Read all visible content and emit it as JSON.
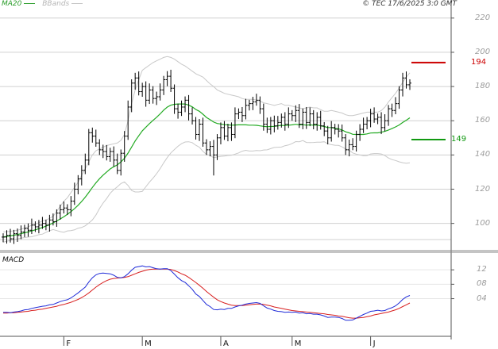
{
  "header": {
    "ma_label": "MA20",
    "bb_label": "BBands",
    "copyright": "© TEC 17/6/2025 3:0 GMT"
  },
  "panels": {
    "macd_title": "MACD"
  },
  "targets": {
    "upper": {
      "value": 194,
      "label": "194",
      "color": "#cc0000"
    },
    "lower": {
      "value": 149,
      "label": "149",
      "color": "#119911"
    }
  },
  "colors": {
    "bars": "#000000",
    "ma": "#22aa22",
    "bb": "#c8c8c8",
    "grid": "#d0d0d0",
    "macd": "#1f2bd8",
    "signal": "#d81f1f",
    "axis": "#555555"
  },
  "chart_data": [
    {
      "type": "ohlc",
      "title": "",
      "y_ticks": [
        "220",
        "200",
        "180",
        "160",
        "140",
        "120",
        "100"
      ],
      "y_tick_values": [
        220,
        200,
        180,
        160,
        140,
        120,
        100
      ],
      "ylim": [
        85,
        225
      ],
      "x_ticks": [
        "F",
        "M",
        "A",
        "M",
        "J"
      ],
      "x_tick_index": [
        17,
        39,
        61,
        81,
        103
      ],
      "grid": true,
      "series": [
        {
          "name": "Price",
          "close": [
            92,
            93,
            91,
            94,
            93,
            95,
            97,
            96,
            99,
            98,
            99,
            100,
            99,
            102,
            101,
            106,
            108,
            109,
            108,
            113,
            120,
            126,
            131,
            137,
            153,
            151,
            147,
            143,
            142,
            139,
            142,
            137,
            131,
            141,
            151,
            168,
            182,
            185,
            177,
            180,
            172,
            178,
            173,
            174,
            178,
            184,
            186,
            179,
            167,
            165,
            168,
            172,
            164,
            160,
            152,
            158,
            147,
            143,
            145,
            140,
            150,
            156,
            151,
            156,
            152,
            164,
            165,
            163,
            169,
            170,
            171,
            172,
            167,
            158,
            155,
            160,
            157,
            159,
            162,
            158,
            164,
            163,
            166,
            158,
            165,
            159,
            164,
            158,
            162,
            157,
            154,
            150,
            156,
            155,
            154,
            150,
            143,
            146,
            145,
            152,
            155,
            158,
            160,
            164,
            161,
            162,
            156,
            160,
            167,
            166,
            170,
            178,
            185,
            181,
            182
          ]
        },
        {
          "name": "MA20",
          "values": [
            92,
            92.4,
            92.7,
            93.1,
            93.5,
            94.0,
            94.5,
            95.0,
            95.6,
            96.2,
            96.9,
            97.6,
            98.4,
            99.3,
            100.3,
            101.4,
            102.6,
            103.9,
            105.3,
            106.9,
            108.6,
            110.6,
            112.8,
            115.3,
            118.1,
            121.0,
            123.7,
            126.1,
            128.2,
            130.0,
            131.8,
            133.1,
            134.2,
            135.9,
            138.1,
            141.1,
            144.6,
            148.2,
            151.2,
            154.1,
            156.2,
            158.3,
            160.2,
            162.0,
            164.0,
            166.2,
            168.0,
            169.1,
            169.6,
            169.8,
            169.8,
            169.8,
            169.1,
            168.1,
            166.6,
            165.5,
            163.8,
            161.9,
            160.6,
            159.2,
            158.4,
            158.1,
            157.7,
            157.6,
            157.4,
            157.5,
            157.6,
            157.6,
            157.6,
            157.4,
            157.4,
            157.3,
            157.0,
            156.7,
            156.5,
            156.6,
            156.7,
            157.0,
            157.3,
            157.2,
            157.4,
            157.6,
            157.9,
            157.6,
            157.7,
            157.4,
            157.6,
            157.4,
            157.5,
            157.0,
            156.6,
            156.0,
            156.0,
            155.6,
            155.3,
            154.6,
            153.5,
            152.9,
            152.1,
            152.0,
            152.0,
            152.0,
            152.3,
            152.8,
            152.9,
            152.9,
            153.3,
            153.8,
            154.6,
            155.4,
            156.4,
            157.5,
            159.0,
            160.3,
            161.7
          ]
        },
        {
          "name": "BBands",
          "upper": [
            95,
            95.2,
            95.4,
            95.7,
            96.0,
            96.6,
            97.3,
            98.0,
            99.0,
            99.6,
            100.4,
            101.5,
            102.0,
            102.9,
            104.2,
            107.0,
            110.0,
            113.0,
            115.0,
            118.0,
            121.0,
            124.0,
            128.0,
            132.0,
            136.0,
            140.0,
            142.5,
            143.5,
            144.5,
            145.5,
            146.0,
            146.5,
            147.0,
            148.5,
            152.0,
            160.0,
            170.0,
            178.0,
            184.0,
            189.5,
            191.0,
            192.5,
            194.0,
            195.0,
            196.0,
            197.0,
            197.5,
            197.0,
            196.0,
            194.5,
            193.0,
            192.0,
            190.5,
            189.0,
            187.5,
            186.5,
            185.5,
            183.5,
            181.5,
            180.0,
            178.0,
            177.0,
            176.0,
            175.5,
            175.0,
            174.5,
            174.0,
            173.0,
            172.5,
            172.5,
            172.5,
            172.0,
            171.5,
            170.5,
            170.0,
            169.5,
            169.0,
            169.5,
            170.0,
            169.0,
            169.0,
            168.5,
            168.0,
            167.5,
            167.0,
            167.5,
            168.0,
            167.5,
            167.5,
            166.5,
            165.5,
            165.5,
            166.0,
            165.5,
            165.0,
            164.5,
            163.5,
            163.0,
            163.0,
            163.5,
            164.0,
            164.5,
            165.0,
            165.0,
            165.0,
            165.0,
            166.0,
            168.0,
            171.0,
            173.5,
            176.0,
            179.0,
            182.5,
            185.5,
            188.0
          ],
          "lower": [
            89,
            89.6,
            90.0,
            90.5,
            91.0,
            91.4,
            91.7,
            92.0,
            92.2,
            92.8,
            93.4,
            93.7,
            94.8,
            95.7,
            96.4,
            95.8,
            95.2,
            94.8,
            95.6,
            95.8,
            96.2,
            97.2,
            97.6,
            98.6,
            100.2,
            102.0,
            104.9,
            108.7,
            111.9,
            114.5,
            117.6,
            119.7,
            121.4,
            123.3,
            124.2,
            122.2,
            119.2,
            118.4,
            118.4,
            118.7,
            121.4,
            124.1,
            126.4,
            129.0,
            132.0,
            135.4,
            138.5,
            141.2,
            143.2,
            145.1,
            146.6,
            147.6,
            147.7,
            147.2,
            145.7,
            144.5,
            142.1,
            140.3,
            139.7,
            138.4,
            138.8,
            139.2,
            139.4,
            139.7,
            139.8,
            140.5,
            141.2,
            142.2,
            142.7,
            142.3,
            142.3,
            142.6,
            142.5,
            142.9,
            143.0,
            143.7,
            144.4,
            144.5,
            144.6,
            145.4,
            145.8,
            146.7,
            147.8,
            147.7,
            148.4,
            147.3,
            147.2,
            147.3,
            147.5,
            147.5,
            147.7,
            146.5,
            146.0,
            145.7,
            145.6,
            144.7,
            143.5,
            142.8,
            141.2,
            140.5,
            140.0,
            139.5,
            139.6,
            140.6,
            140.8,
            140.8,
            140.6,
            139.6,
            138.2,
            137.3,
            136.8,
            136.0,
            135.5,
            135.1,
            135.4
          ]
        }
      ]
    },
    {
      "type": "line",
      "title": "MACD",
      "y_ticks": [
        "12",
        "08",
        "04"
      ],
      "y_tick_values": [
        12,
        8,
        4
      ],
      "ylim": [
        -6,
        16
      ],
      "series": [
        {
          "name": "MACD",
          "values": [
            0.2,
            0.2,
            0.1,
            0.3,
            0.4,
            0.6,
            0.9,
            1.0,
            1.3,
            1.5,
            1.7,
            1.9,
            2.0,
            2.3,
            2.4,
            2.8,
            3.2,
            3.5,
            3.7,
            4.2,
            4.9,
            5.6,
            6.4,
            7.2,
            8.6,
            9.8,
            10.6,
            11.0,
            11.1,
            11.0,
            10.9,
            10.5,
            9.9,
            9.8,
            10.1,
            10.9,
            11.9,
            12.7,
            12.9,
            13.1,
            12.8,
            12.9,
            12.6,
            12.3,
            12.2,
            12.3,
            12.3,
            11.8,
            10.8,
            9.8,
            9.0,
            8.5,
            7.6,
            6.6,
            5.3,
            4.6,
            3.5,
            2.4,
            1.8,
            1.0,
            0.9,
            1.1,
            1.0,
            1.3,
            1.3,
            1.7,
            2.0,
            2.2,
            2.5,
            2.7,
            2.8,
            2.9,
            2.7,
            2.0,
            1.4,
            1.1,
            0.7,
            0.5,
            0.4,
            0.2,
            0.3,
            0.2,
            0.3,
            0.0,
            0.1,
            -0.2,
            -0.1,
            -0.3,
            -0.3,
            -0.5,
            -0.8,
            -1.2,
            -1.1,
            -1.1,
            -1.2,
            -1.5,
            -2.0,
            -2.0,
            -1.9,
            -1.4,
            -0.9,
            -0.4,
            0.0,
            0.5,
            0.6,
            0.8,
            0.6,
            0.7,
            1.2,
            1.5,
            2.0,
            2.8,
            3.8,
            4.5,
            4.9
          ]
        },
        {
          "name": "Signal",
          "values": [
            0.0,
            0.0,
            0.1,
            0.1,
            0.2,
            0.3,
            0.4,
            0.5,
            0.7,
            0.8,
            1.0,
            1.1,
            1.3,
            1.5,
            1.7,
            1.9,
            2.2,
            2.4,
            2.7,
            3.0,
            3.4,
            3.8,
            4.3,
            4.9,
            5.6,
            6.4,
            7.2,
            7.9,
            8.5,
            9.0,
            9.4,
            9.6,
            9.7,
            9.8,
            9.9,
            10.1,
            10.5,
            10.9,
            11.3,
            11.6,
            11.9,
            12.1,
            12.2,
            12.2,
            12.2,
            12.2,
            12.2,
            12.1,
            11.8,
            11.4,
            10.9,
            10.5,
            9.9,
            9.2,
            8.5,
            7.7,
            6.9,
            6.0,
            5.2,
            4.4,
            3.7,
            3.2,
            2.8,
            2.5,
            2.2,
            2.1,
            2.1,
            2.1,
            2.2,
            2.3,
            2.4,
            2.5,
            2.5,
            2.4,
            2.2,
            2.0,
            1.7,
            1.5,
            1.3,
            1.1,
            0.9,
            0.7,
            0.6,
            0.5,
            0.4,
            0.3,
            0.2,
            0.1,
            0.0,
            -0.1,
            -0.2,
            -0.4,
            -0.5,
            -0.6,
            -0.8,
            -0.9,
            -1.1,
            -1.3,
            -1.4,
            -1.4,
            -1.3,
            -1.2,
            -1.0,
            -0.8,
            -0.5,
            -0.3,
            -0.1,
            0.1,
            0.3,
            0.6,
            0.9,
            1.3,
            1.8,
            2.3,
            2.8
          ]
        }
      ]
    }
  ]
}
